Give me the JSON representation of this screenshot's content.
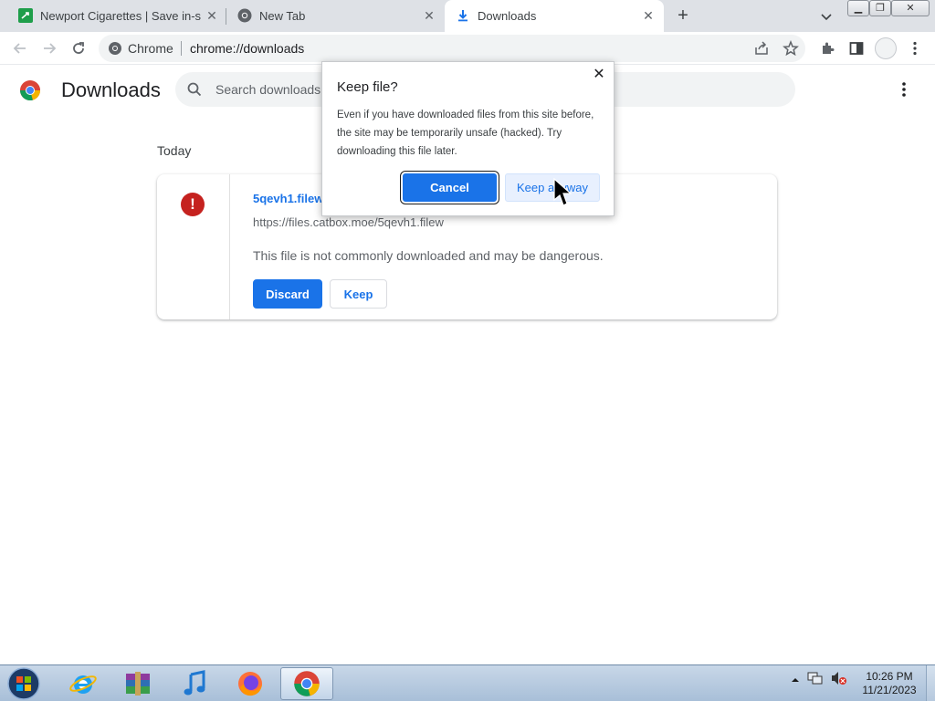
{
  "browser": {
    "tabs": [
      {
        "title": "Newport Cigarettes | Save in-stoc",
        "active": false
      },
      {
        "title": "New Tab",
        "active": false
      },
      {
        "title": "Downloads",
        "active": true
      }
    ],
    "omnibox": {
      "chip": "Chrome",
      "url": "chrome://downloads"
    }
  },
  "downloads": {
    "title": "Downloads",
    "search_placeholder": "Search downloads",
    "date_header": "Today",
    "item": {
      "file_name": "5qevh1.filew",
      "url": "https://files.catbox.moe/5qevh1.filew",
      "warning": "This file is not commonly downloaded and may be dangerous.",
      "discard_label": "Discard",
      "keep_label": "Keep"
    }
  },
  "dialog": {
    "title": "Keep file?",
    "body": "Even if you have downloaded files from this site before, the site may be temporarily unsafe (hacked). Try downloading this file later.",
    "cancel_label": "Cancel",
    "keep_anyway_label": "Keep anyway"
  },
  "taskbar": {
    "apps": [
      "start-orb",
      "internet-explorer",
      "winrar",
      "itunes",
      "firefox",
      "chrome"
    ],
    "time": "10:26 PM",
    "date": "11/21/2023"
  },
  "colors": {
    "accent": "#1a73e8",
    "danger": "#c5221f"
  }
}
